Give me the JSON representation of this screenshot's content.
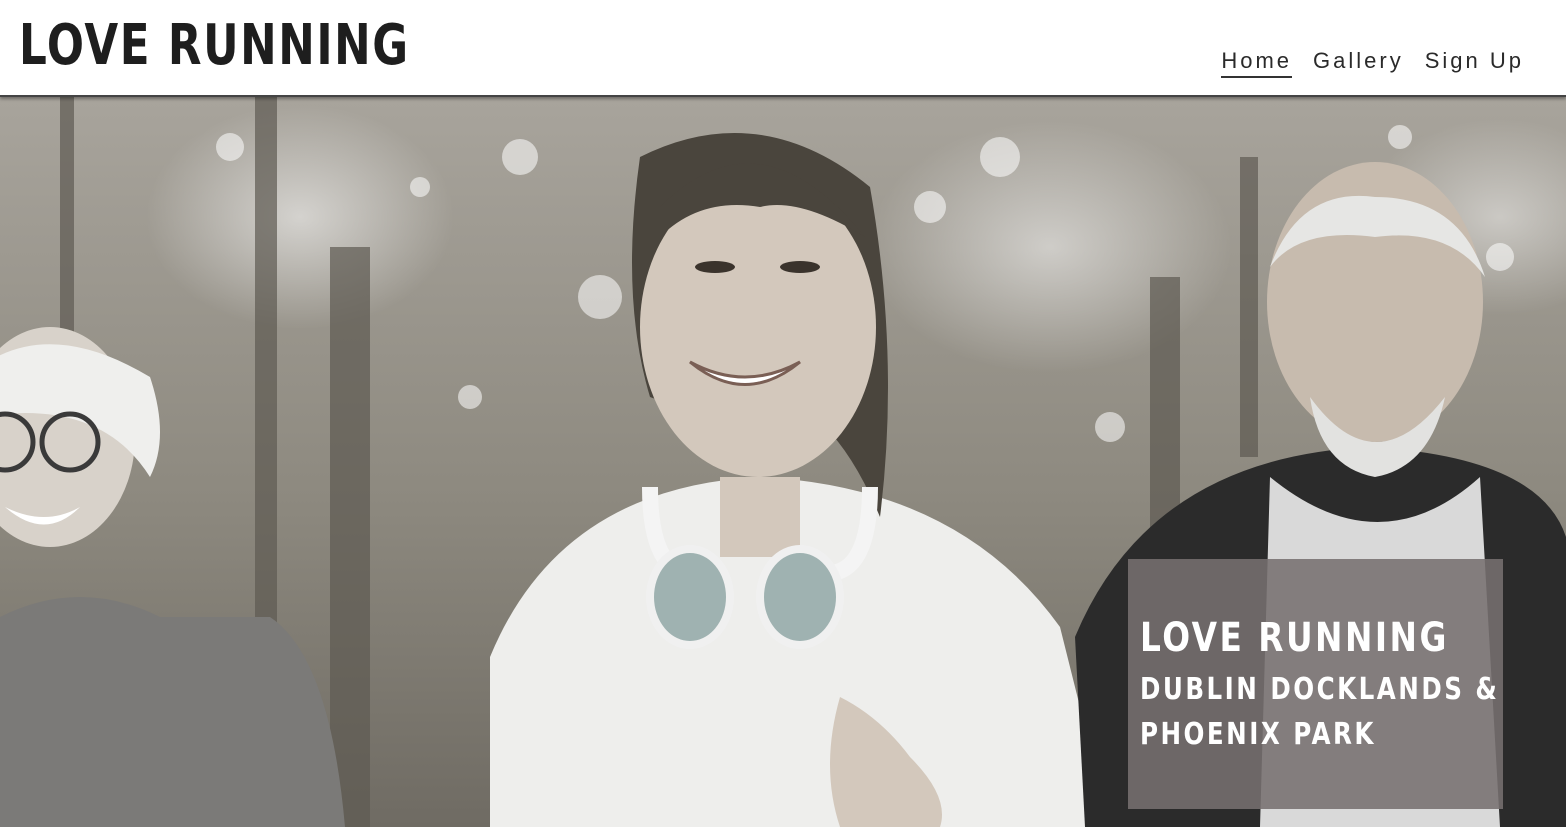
{
  "header": {
    "logo": "LOVE RUNNING",
    "nav": [
      {
        "label": "Home",
        "active": true
      },
      {
        "label": "Gallery",
        "active": false
      },
      {
        "label": "Sign Up",
        "active": false
      }
    ]
  },
  "hero": {
    "image_description_icon": "runners-photo",
    "caption": {
      "title": "LOVE RUNNING",
      "line1": "DUBLIN DOCKLANDS &",
      "line2": "PHOENIX PARK"
    }
  },
  "colors": {
    "header_bg": "#ffffff",
    "text_dark": "#1e1e1e",
    "caption_bg": "#767070",
    "caption_text": "#ffffff"
  }
}
